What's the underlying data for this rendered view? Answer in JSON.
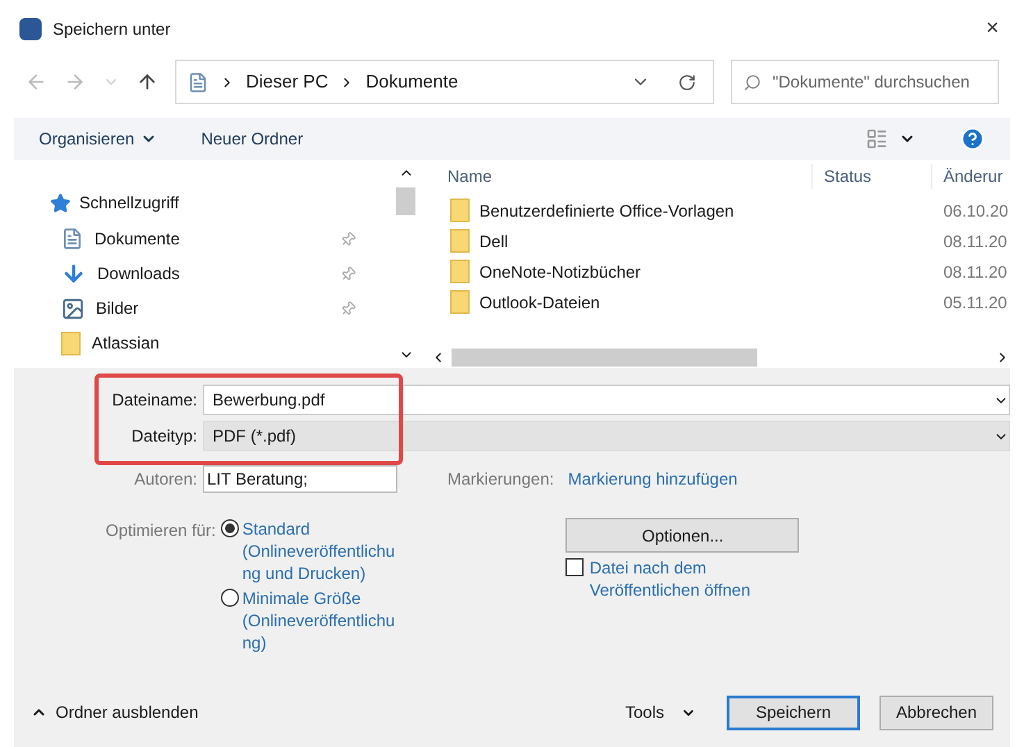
{
  "window": {
    "title": "Speichern unter",
    "close": "×"
  },
  "address_bar": {
    "path": [
      "Dieser PC",
      "Dokumente"
    ]
  },
  "search": {
    "placeholder": "\"Dokumente\" durchsuchen"
  },
  "toolbar": {
    "organize": "Organisieren",
    "new_folder": "Neuer Ordner"
  },
  "sidebar": {
    "header": "Schnellzugriff",
    "items": [
      {
        "label": "Dokumente",
        "kind": "documents",
        "pinned": true
      },
      {
        "label": "Downloads",
        "kind": "download",
        "pinned": true
      },
      {
        "label": "Bilder",
        "kind": "pictures",
        "pinned": true
      },
      {
        "label": "Atlassian",
        "kind": "folder",
        "pinned": false
      }
    ]
  },
  "file_list": {
    "columns": [
      "Name",
      "Status",
      "Änderur"
    ],
    "rows": [
      {
        "name": "Benutzerdefinierte Office-Vorlagen",
        "date": "06.10.20"
      },
      {
        "name": "Dell",
        "date": "08.11.20"
      },
      {
        "name": "OneNote-Notizbücher",
        "date": "08.11.20"
      },
      {
        "name": "Outlook-Dateien",
        "date": "05.11.20"
      }
    ]
  },
  "form": {
    "filename_label": "Dateiname:",
    "filename": "Bewerbung.pdf",
    "filetype_label": "Dateityp:",
    "filetype": "PDF (*.pdf)",
    "authors_label": "Autoren:",
    "authors": "LIT Beratung;",
    "tags_label": "Markierungen:",
    "tags_link": "Markierung hinzufügen",
    "highlighted": true
  },
  "optimize": {
    "label": "Optimieren für:",
    "options": [
      {
        "lines": [
          "Standard",
          "(Onlineveröffentlichu",
          "ng und Drucken)"
        ],
        "selected": true
      },
      {
        "lines": [
          "Minimale Größe",
          "(Onlineveröffentlichu",
          "ng)"
        ],
        "selected": false
      }
    ]
  },
  "options_button": "Optionen...",
  "open_after": {
    "lines": [
      "Datei nach dem",
      "Veröffentlichen öffnen"
    ],
    "checked": false
  },
  "footer": {
    "hide_folders": "Ordner ausblenden",
    "tools": "Tools",
    "save": "Speichern",
    "cancel": "Abbrechen"
  }
}
